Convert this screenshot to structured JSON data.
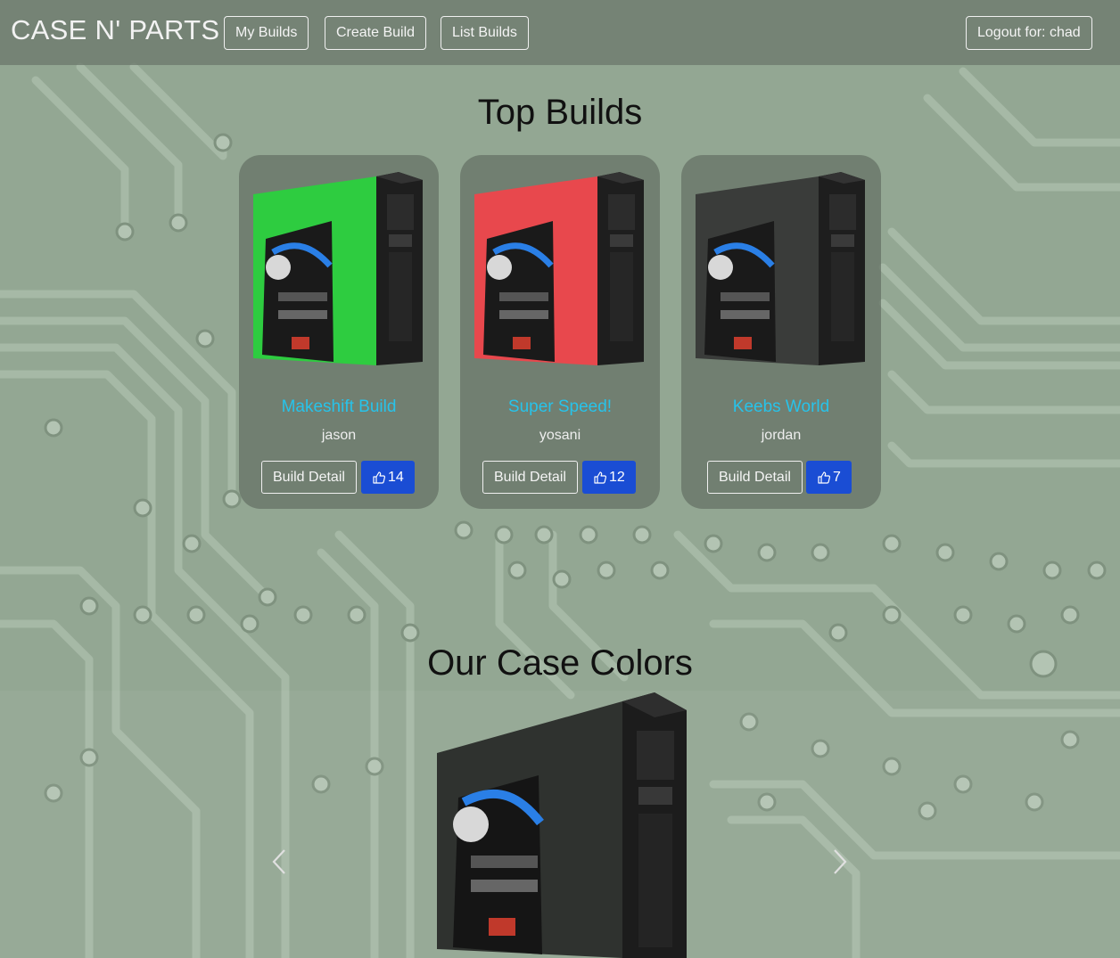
{
  "nav": {
    "brand": "CASE N' PARTS",
    "links": [
      "My Builds",
      "Create Build",
      "List Builds"
    ],
    "logout": "Logout for: chad"
  },
  "top_builds": {
    "title": "Top Builds",
    "cards": [
      {
        "name": "Makeshift Build",
        "user": "jason",
        "detail": "Build Detail",
        "likes": "14",
        "panel_color": "#2ecc40"
      },
      {
        "name": "Super Speed!",
        "user": "yosani",
        "detail": "Build Detail",
        "likes": "12",
        "panel_color": "#e8484d"
      },
      {
        "name": "Keebs World",
        "user": "jordan",
        "detail": "Build Detail",
        "likes": "7",
        "panel_color": "#3a3c3a"
      }
    ]
  },
  "case_colors": {
    "title": "Our Case Colors",
    "prev_icon": "chevron-left-icon",
    "next_icon": "chevron-right-icon"
  },
  "colors": {
    "accent_link": "#27c3ea",
    "like_button": "#1a4dd4",
    "navbar": "#6e7a6e"
  }
}
